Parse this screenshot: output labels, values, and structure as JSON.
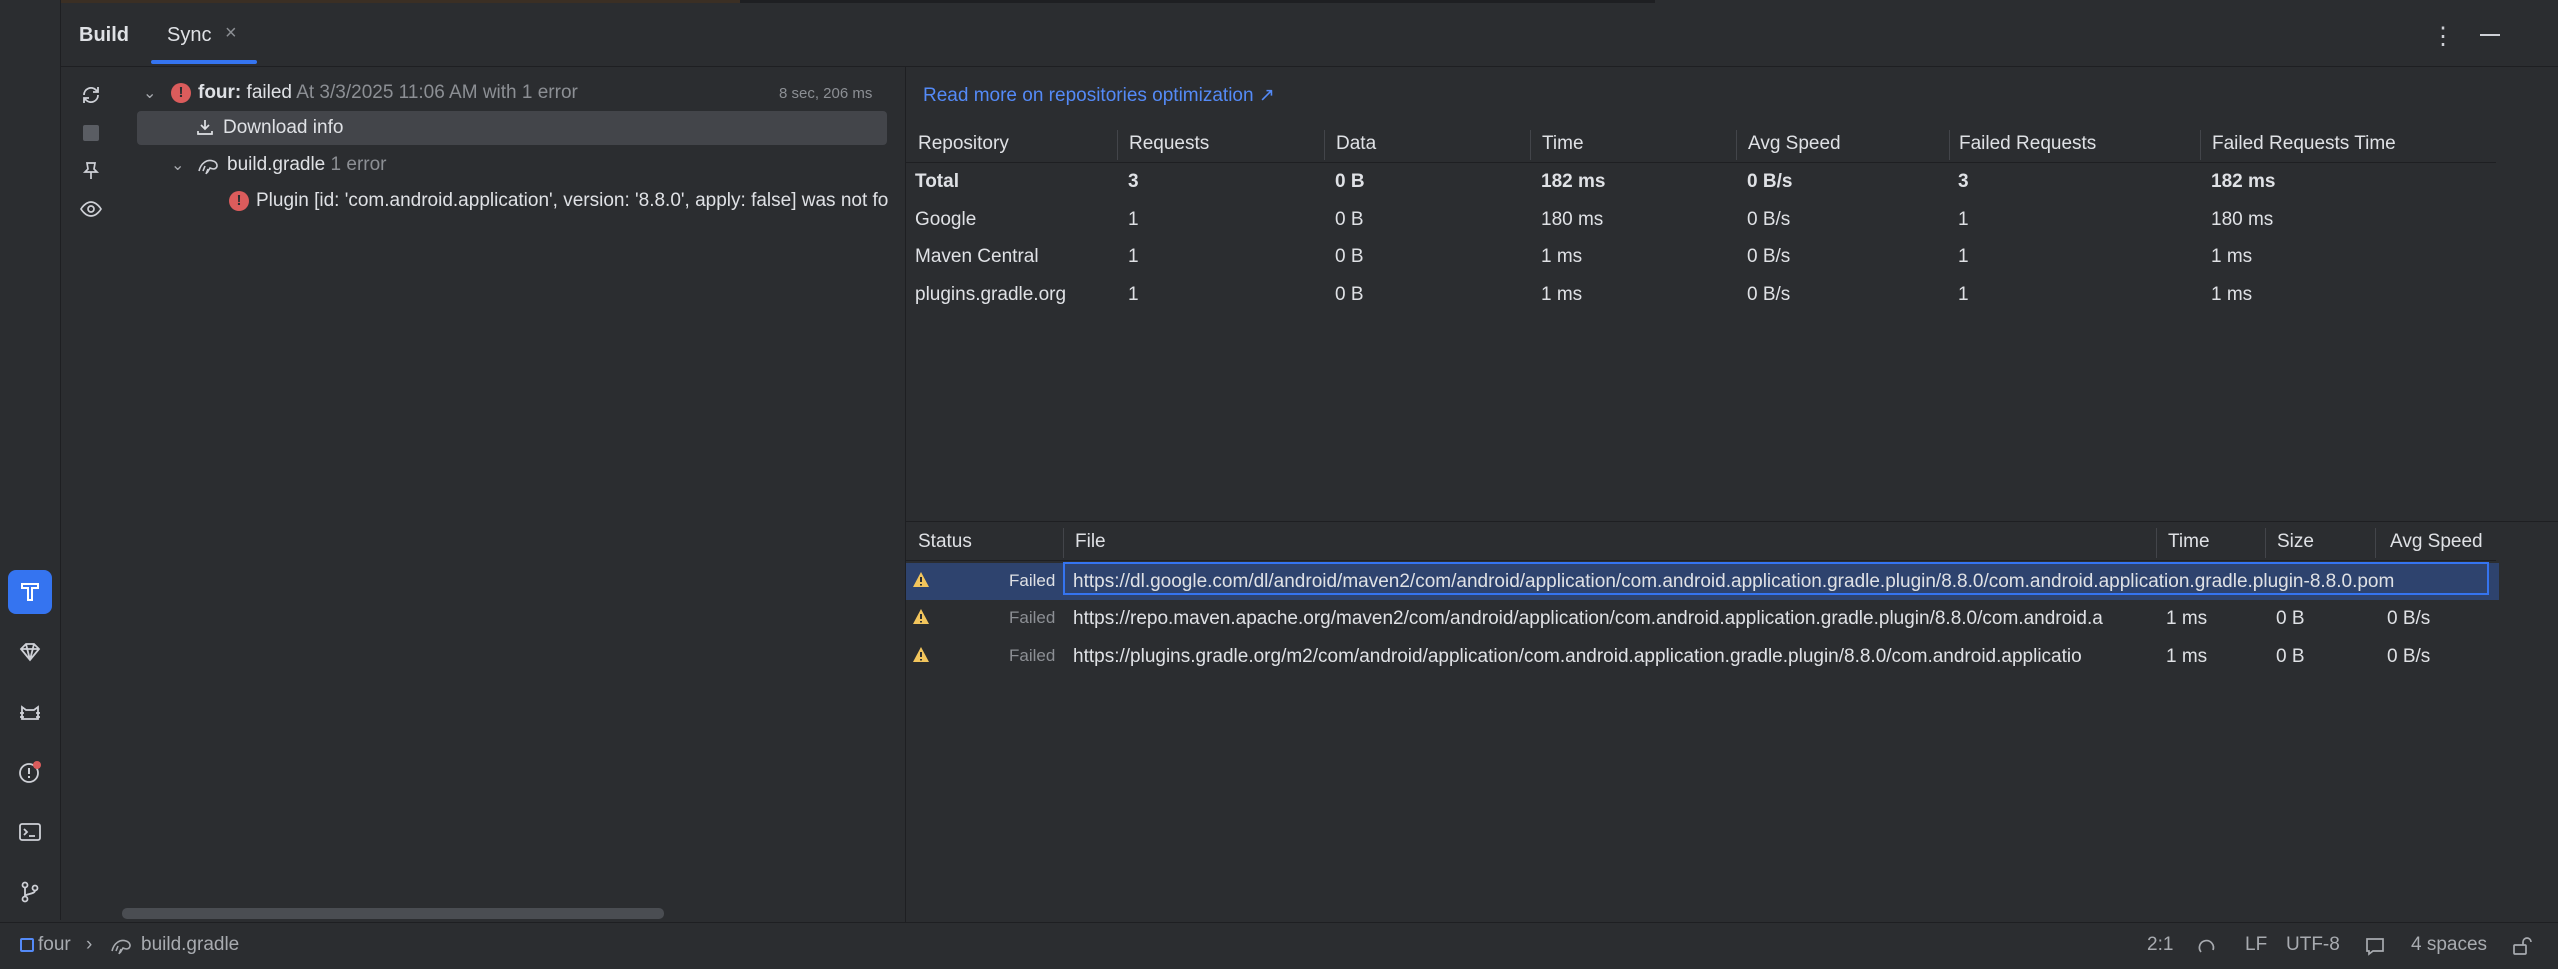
{
  "header": {
    "tabs": [
      {
        "label": "Build"
      },
      {
        "label": "Sync"
      }
    ],
    "close_glyph": "×"
  },
  "tree": {
    "root": {
      "name": "four:",
      "status": "failed",
      "detail": "At 3/3/2025 11:06 AM with 1 error",
      "duration": "8 sec, 206 ms"
    },
    "download": {
      "label": "Download info"
    },
    "file": {
      "name": "build.gradle",
      "count": "1 error"
    },
    "error": {
      "message": "Plugin [id: 'com.android.application', version: '8.8.0', apply: false] was not fo"
    }
  },
  "repositories": {
    "link": "Read more on repositories optimization ↗",
    "columns": [
      "Repository",
      "Requests",
      "Data",
      "Time",
      "Avg Speed",
      "Failed Requests",
      "Failed Requests Time"
    ],
    "rows": [
      [
        "Total",
        "3",
        "0 B",
        "182 ms",
        "0 B/s",
        "3",
        "182 ms"
      ],
      [
        "Google",
        "1",
        "0 B",
        "180 ms",
        "0 B/s",
        "1",
        "180 ms"
      ],
      [
        "Maven Central",
        "1",
        "0 B",
        "1 ms",
        "0 B/s",
        "1",
        "1 ms"
      ],
      [
        "plugins.gradle.org",
        "1",
        "0 B",
        "1 ms",
        "0 B/s",
        "1",
        "1 ms"
      ]
    ]
  },
  "requests": {
    "columns": [
      "Status",
      "File",
      "Time",
      "Size",
      "Avg Speed"
    ],
    "rows": [
      {
        "status": "Failed",
        "file": "https://dl.google.com/dl/android/maven2/com/android/application/com.android.application.gradle.plugin/8.8.0/com.android.application.gradle.plugin-8.8.0.pom",
        "time": "",
        "size": "",
        "speed": ""
      },
      {
        "status": "Failed",
        "file": "https://repo.maven.apache.org/maven2/com/android/application/com.android.application.gradle.plugin/8.8.0/com.android.a",
        "time": "1 ms",
        "size": "0 B",
        "speed": "0 B/s"
      },
      {
        "status": "Failed",
        "file": "https://plugins.gradle.org/m2/com/android/application/com.android.application.gradle.plugin/8.8.0/com.android.applicatio",
        "time": "1 ms",
        "size": "0 B",
        "speed": "0 B/s"
      }
    ]
  },
  "statusbar": {
    "project": "four",
    "file": "build.gradle",
    "position": "2:1",
    "line_ending": "LF",
    "encoding": "UTF-8",
    "indent": "4 spaces"
  },
  "colors": {
    "accent": "#3574f0",
    "error": "#db5c5c",
    "warning": "#f2c55c",
    "link": "#548af7"
  },
  "icons": [
    "sync-icon",
    "stop-icon",
    "pin-icon",
    "eye-icon",
    "build-icon",
    "gem-icon",
    "cat-icon",
    "problems-icon",
    "terminal-icon",
    "git-icon",
    "more-icon",
    "minimize-icon",
    "download-icon",
    "gradle-icon",
    "warning-icon",
    "error-icon",
    "lock-icon"
  ]
}
